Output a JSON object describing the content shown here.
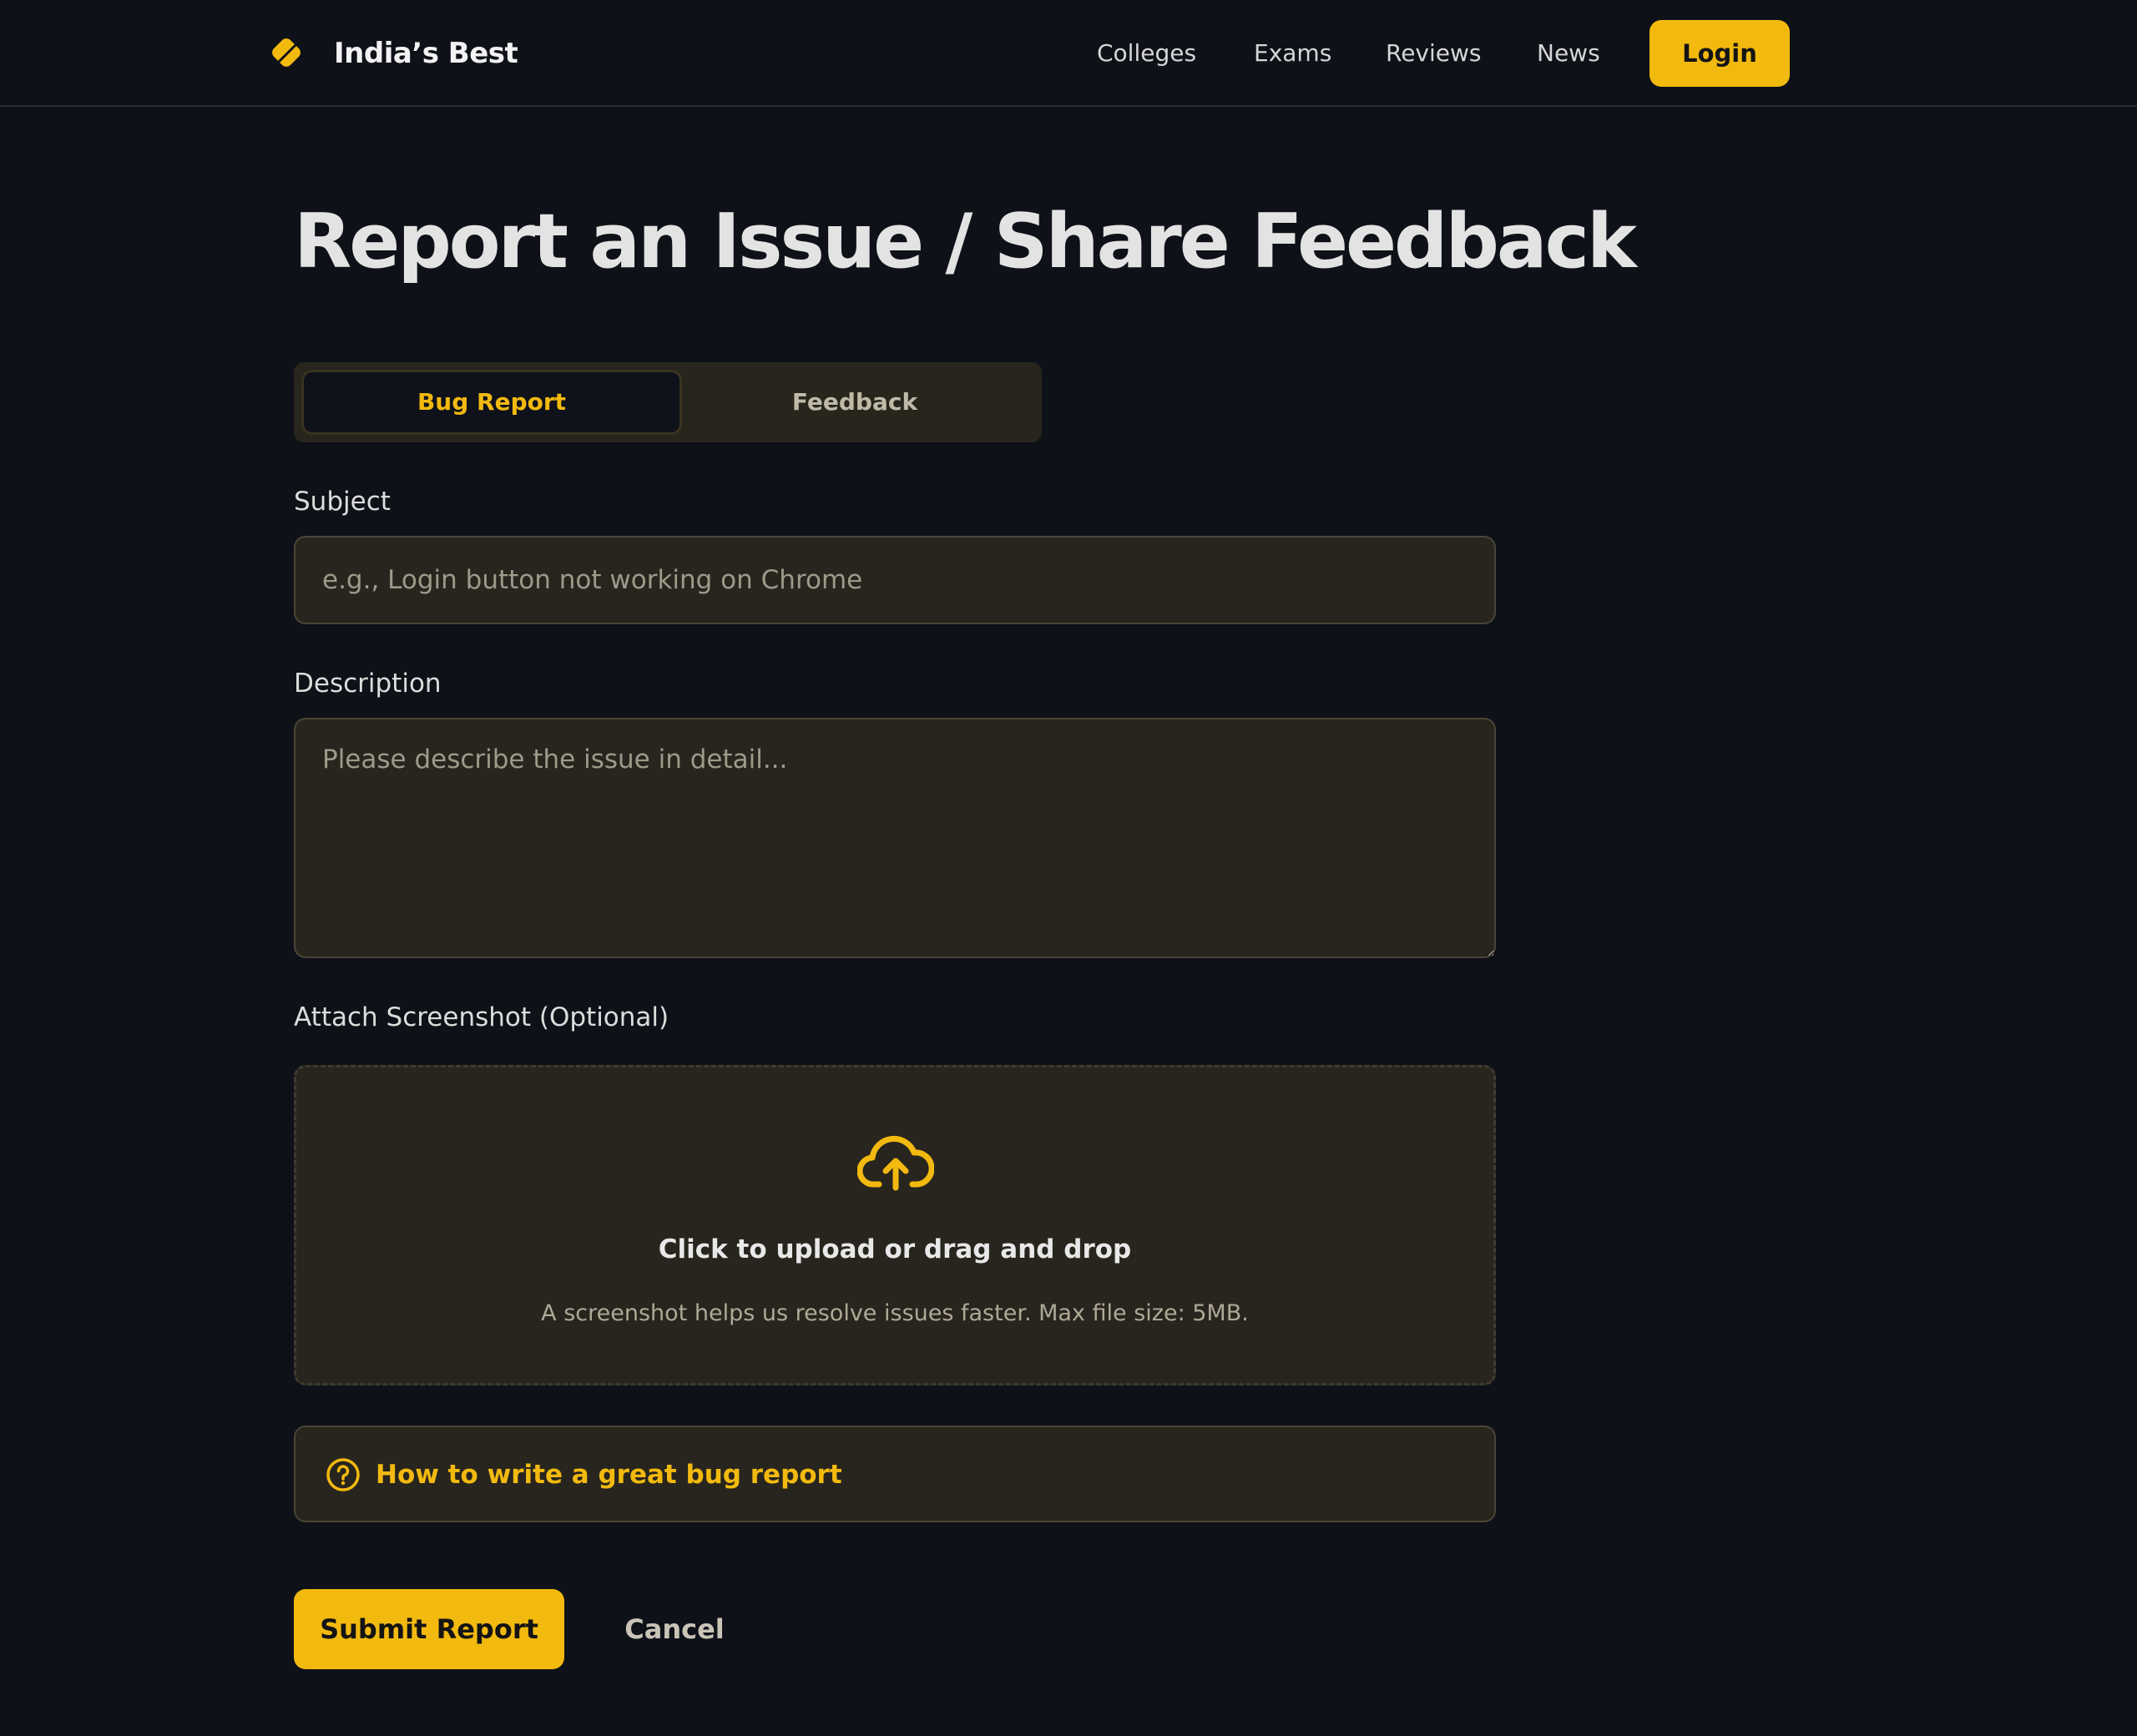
{
  "header": {
    "brand": "India’s Best",
    "logo_icon": "diamond-logo-icon",
    "nav": [
      "Colleges",
      "Exams",
      "Reviews",
      "News"
    ],
    "login_label": "Login"
  },
  "page_title": "Report an Issue / Share Feedback",
  "tabs": [
    {
      "label": "Bug Report",
      "active": true
    },
    {
      "label": "Feedback",
      "active": false
    }
  ],
  "form": {
    "subject_label": "Subject",
    "subject_placeholder": "e.g., Login button not working on Chrome",
    "subject_value": "",
    "description_label": "Description",
    "description_placeholder": "Please describe the issue in detail...",
    "description_value": "",
    "attach_label": "Attach Screenshot (Optional)",
    "upload_icon": "cloud-upload-icon",
    "upload_title": "Click to upload or drag and drop",
    "upload_hint": "A screenshot helps us resolve issues faster. Max file size: 5MB."
  },
  "help": {
    "icon": "question-circle-icon",
    "text": "How to write a great bug report"
  },
  "actions": {
    "submit_label": "Submit Report",
    "cancel_label": "Cancel"
  },
  "colors": {
    "accent": "#f2b90f",
    "background": "#0e1118",
    "surface": "#28251e"
  }
}
